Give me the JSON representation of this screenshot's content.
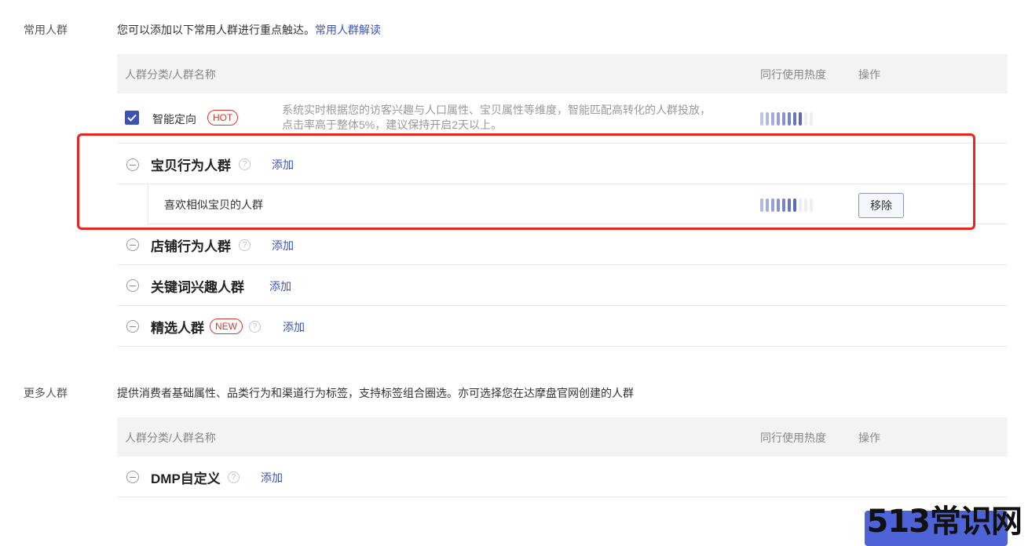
{
  "common": {
    "label": "常用人群",
    "desc": "您可以添加以下常用人群进行重点触达。",
    "desc_link": "常用人群解读",
    "header": {
      "name": "人群分类/人群名称",
      "heat": "同行使用热度",
      "action": "操作"
    },
    "smart": {
      "label": "智能定向",
      "badge": "HOT",
      "desc_line1": "系统实时根据您的访客兴趣与人口属性、宝贝属性等维度，智能匹配高转化的人群投放，",
      "desc_line2": "点击率高于整体5%，建议保持开启2天以上。",
      "heat_level": 0.8,
      "checked": true
    },
    "groups": [
      {
        "title": "宝贝行为人群",
        "add": "添加",
        "children": [
          {
            "name": "喜欢相似宝贝的人群",
            "heat_level": 0.7,
            "action": "移除"
          }
        ]
      },
      {
        "title": "店铺行为人群",
        "add": "添加"
      },
      {
        "title": "关键词兴趣人群",
        "add": "添加"
      },
      {
        "title": "精选人群",
        "badge": "NEW",
        "add": "添加"
      }
    ]
  },
  "more": {
    "label": "更多人群",
    "desc": "提供消费者基础属性、品类行为和渠道行为标签，支持标签组合圈选。亦可选择您在达摩盘官网创建的人群",
    "header": {
      "name": "人群分类/人群名称",
      "heat": "同行使用热度",
      "action": "操作"
    },
    "groups": [
      {
        "title": "DMP自定义",
        "add": "添加"
      }
    ]
  },
  "watermark": "513常识网",
  "colors": {
    "accent": "#3b53b7",
    "hot": "#d8382a",
    "highlight": "#e8261e"
  }
}
